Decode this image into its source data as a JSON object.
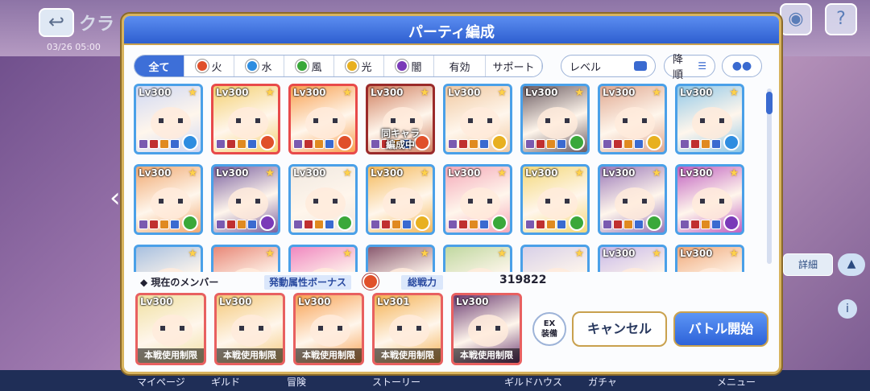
{
  "background": {
    "title_fragment": "クラ",
    "date_fragment": "03/26 05:00",
    "right_button_label": "詳細",
    "bottom_tabs": [
      "マイページ",
      "ギルド",
      "冒険",
      "ストーリー",
      "",
      "ギルドハウス",
      "ガチャ",
      "メニュー"
    ]
  },
  "dialog": {
    "title": "パーティ編成"
  },
  "filters": {
    "tabs": [
      {
        "label": "全て",
        "element": "",
        "active": true
      },
      {
        "label": "火",
        "element": "fire"
      },
      {
        "label": "水",
        "element": "water"
      },
      {
        "label": "風",
        "element": "wind"
      },
      {
        "label": "光",
        "element": "light"
      },
      {
        "label": "闇",
        "element": "dark"
      },
      {
        "label": "有効",
        "element": ""
      },
      {
        "label": "サポート",
        "element": ""
      }
    ],
    "sort_label": "レベル",
    "order_label": "降順"
  },
  "element_colors": {
    "fire": "#e0502a",
    "water": "#2e8de0",
    "wind": "#3aa83a",
    "light": "#e8b020",
    "dark": "#7a3ab8"
  },
  "roster": [
    {
      "lv": "Lv300",
      "border": "blue",
      "elem": "water",
      "hue": "#cfd8f4",
      "overlay": ""
    },
    {
      "lv": "Lv300",
      "border": "red",
      "elem": "fire",
      "hue": "#f4d070",
      "overlay": ""
    },
    {
      "lv": "Lv300",
      "border": "red",
      "elem": "fire",
      "hue": "#f8a050",
      "overlay": ""
    },
    {
      "lv": "Lv300",
      "border": "dark",
      "elem": "fire",
      "hue": "#d08060",
      "overlay": "同キャラ\n編成中"
    },
    {
      "lv": "Lv300",
      "border": "blue",
      "elem": "light",
      "hue": "#f0c8a0",
      "overlay": ""
    },
    {
      "lv": "Lv300",
      "border": "blue",
      "elem": "wind",
      "hue": "#6a5a60",
      "overlay": ""
    },
    {
      "lv": "Lv300",
      "border": "blue",
      "elem": "light",
      "hue": "#e0a890",
      "overlay": ""
    },
    {
      "lv": "Lv300",
      "border": "blue",
      "elem": "water",
      "hue": "#90c8e8",
      "overlay": ""
    },
    {
      "lv": "Lv300",
      "border": "blue",
      "elem": "wind",
      "hue": "#f0a870",
      "overlay": ""
    },
    {
      "lv": "Lv300",
      "border": "blue",
      "elem": "dark",
      "hue": "#7a60a0",
      "overlay": ""
    },
    {
      "lv": "Lv300",
      "border": "blue",
      "elem": "wind",
      "hue": "#f0e8e0",
      "overlay": ""
    },
    {
      "lv": "Lv300",
      "border": "blue",
      "elem": "light",
      "hue": "#f4b858",
      "overlay": ""
    },
    {
      "lv": "Lv300",
      "border": "blue",
      "elem": "wind",
      "hue": "#f4a8b8",
      "overlay": ""
    },
    {
      "lv": "Lv300",
      "border": "blue",
      "elem": "wind",
      "hue": "#f4d878",
      "overlay": ""
    },
    {
      "lv": "Lv300",
      "border": "blue",
      "elem": "wind",
      "hue": "#9a78b8",
      "overlay": ""
    },
    {
      "lv": "Lv300",
      "border": "blue",
      "elem": "dark",
      "hue": "#c060c0",
      "overlay": ""
    },
    {
      "lv": "",
      "border": "blue",
      "elem": "",
      "hue": "#a8c0e0",
      "overlay": ""
    },
    {
      "lv": "",
      "border": "blue",
      "elem": "",
      "hue": "#e88878",
      "overlay": ""
    },
    {
      "lv": "",
      "border": "blue",
      "elem": "",
      "hue": "#f088c0",
      "overlay": ""
    },
    {
      "lv": "",
      "border": "blue",
      "elem": "",
      "hue": "#8a5a70",
      "overlay": ""
    },
    {
      "lv": "",
      "border": "blue",
      "elem": "",
      "hue": "#c0d8a0",
      "overlay": ""
    },
    {
      "lv": "",
      "border": "blue",
      "elem": "",
      "hue": "#d8d0e8",
      "overlay": ""
    },
    {
      "lv": "Lv300",
      "border": "blue",
      "elem": "",
      "hue": "#c8b8e8",
      "overlay": ""
    },
    {
      "lv": "Lv300",
      "border": "blue",
      "elem": "",
      "hue": "#f0a878",
      "overlay": ""
    }
  ],
  "party": {
    "section_label": "現在のメンバー",
    "bonus_label": "発動属性ボーナス",
    "power_label": "総戦力",
    "power_value": "319822",
    "members": [
      {
        "lv": "Lv300",
        "hue": "#f0e0a0",
        "limit": "本戦使用制限"
      },
      {
        "lv": "Lv300",
        "hue": "#f4c878",
        "limit": "本戦使用制限"
      },
      {
        "lv": "Lv300",
        "hue": "#f8a050",
        "limit": "本戦使用制限"
      },
      {
        "lv": "Lv301",
        "hue": "#f4b050",
        "limit": "本戦使用制限"
      },
      {
        "lv": "Lv300",
        "hue": "#6a3a70",
        "limit": "本戦使用制限"
      }
    ]
  },
  "actions": {
    "ex_label": "EX\n装備",
    "cancel_label": "キャンセル",
    "battle_label": "バトル開始"
  }
}
